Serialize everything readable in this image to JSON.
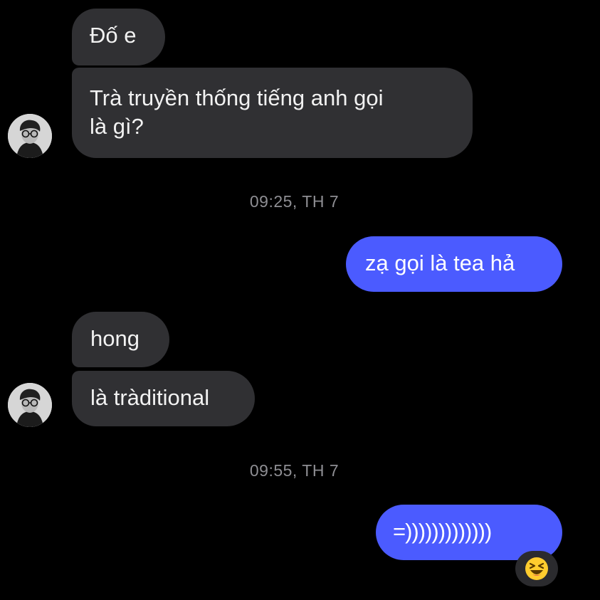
{
  "thread": {
    "messages_1": {
      "msg_1": "Đố e",
      "msg_2_line_1": "Trà truyền thống tiếng anh gọi",
      "msg_2_line_2": "là gì?"
    },
    "timestamp_1": "09:25, TH 7",
    "sent_1": "zạ gọi là tea hả",
    "messages_2": {
      "msg_1": "hong",
      "msg_2": "là tràditional"
    },
    "timestamp_2": "09:55, TH 7",
    "sent_2": "=)))))))))))))"
  },
  "reaction": {
    "icon": "grinning-squinting-face-emoji"
  },
  "colors": {
    "background": "#000000",
    "incoming_bubble": "#303033",
    "outgoing_bubble": "#4b5bff",
    "timestamp_text": "#8e8e93"
  }
}
